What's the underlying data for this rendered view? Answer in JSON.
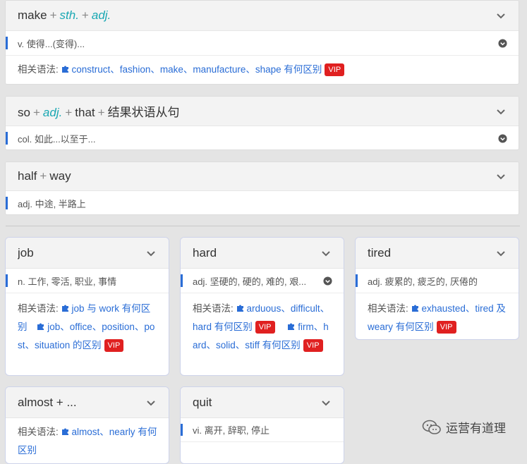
{
  "entries": [
    {
      "title_parts": [
        [
          "make",
          "plain"
        ],
        [
          "+",
          "plus"
        ],
        [
          "sth.",
          "ital"
        ],
        [
          "+",
          "plus"
        ],
        [
          "adj.",
          "ital"
        ]
      ],
      "definition": "v. 使得...(变得)...",
      "related_label": "相关语法:",
      "related_link": "construct、fashion、make、manufacture、shape 有何区别",
      "vip": "VIP"
    },
    {
      "title_parts": [
        [
          "so",
          "plain"
        ],
        [
          "+",
          "plus"
        ],
        [
          "adj.",
          "ital"
        ],
        [
          "+",
          "plus"
        ],
        [
          "that",
          "plain"
        ],
        [
          "+",
          "plus"
        ],
        [
          "结果状语从句",
          "plain"
        ]
      ],
      "definition": "col. 如此...以至于..."
    },
    {
      "title_parts": [
        [
          "half",
          "plain"
        ],
        [
          "+",
          "plus"
        ],
        [
          "way",
          "plain"
        ]
      ],
      "definition": "adj. 中途, 半路上"
    }
  ],
  "grid": [
    {
      "title": "job",
      "definition": "n. 工作, 零活, 职业, 事情",
      "related_label": "相关语法:",
      "links": [
        {
          "pre": "",
          "text": "job 与 work 有何区别",
          "vip": ""
        },
        {
          "pre": "",
          "text": "job、office、position、post、situation 的区别",
          "vip": "VIP"
        }
      ]
    },
    {
      "title": "hard",
      "definition": "adj. 坚硬的, 硬的, 难的, 艰...",
      "related_label": "相关语法:",
      "links": [
        {
          "pre": "",
          "text": "arduous、difficult、hard 有何区别",
          "vip": "VIP"
        },
        {
          "pre": "",
          "text": "firm、hard、solid、stiff 有何区别",
          "vip": "VIP"
        }
      ]
    },
    {
      "title": "tired",
      "definition": "adj. 疲累的, 疲乏的, 厌倦的",
      "related_label": "相关语法:",
      "links": [
        {
          "pre": "",
          "text": "exhausted、tired 及 weary 有何区别",
          "vip": "VIP"
        }
      ]
    },
    {
      "title": "almost + ...",
      "related_label": "相关语法:",
      "links": [
        {
          "pre": "",
          "text": "almost、nearly 有何区别",
          "vip": ""
        }
      ]
    },
    {
      "title": "quit",
      "definition": "vi. 离开, 辞职, 停止"
    }
  ],
  "watermark": "运营有道理",
  "colors": {
    "accent": "#2a6dd6",
    "vip": "#e02020",
    "keyword": "#1aa8b3"
  }
}
